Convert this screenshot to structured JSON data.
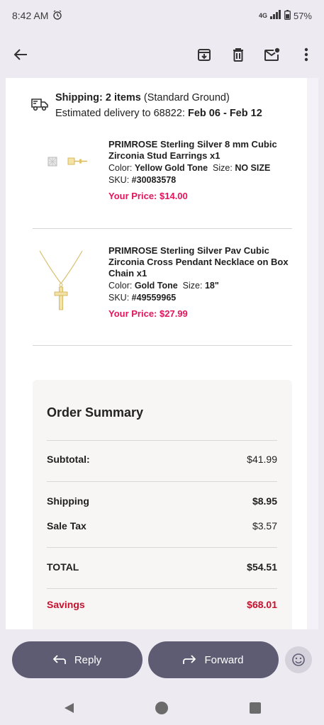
{
  "status_bar": {
    "time": "8:42 AM",
    "network": "4G",
    "battery": "57%"
  },
  "toolbar": {
    "back_icon": "arrow-left-icon",
    "archive_icon": "archive-icon",
    "delete_icon": "trash-icon",
    "mark_unread_icon": "mail-unread-icon",
    "more_icon": "more-vert-icon"
  },
  "shipping": {
    "label": "Shipping: 2 items",
    "method": "(Standard Ground)",
    "delivery_prefix": "Estimated delivery to 68822:",
    "delivery_dates": "Feb 06 - Feb 12"
  },
  "items": [
    {
      "name": "PRIMROSE Sterling Silver 8 mm Cubic Zirconia Stud Earrings x1",
      "color_label": "Color:",
      "color_value": "Yellow Gold Tone",
      "size_label": "Size:",
      "size_value": "NO SIZE",
      "sku_label": "SKU:",
      "sku_value": "#30083578",
      "price": "Your Price: $14.00"
    },
    {
      "name": "PRIMROSE Sterling Silver Pav Cubic Zirconia Cross Pendant Necklace on Box Chain x1",
      "color_label": "Color:",
      "color_value": "Gold Tone",
      "size_label": "Size:",
      "size_value": "18\"",
      "sku_label": "SKU:",
      "sku_value": "#49559965",
      "price": "Your Price: $27.99"
    }
  ],
  "summary": {
    "title": "Order Summary",
    "subtotal_label": "Subtotal:",
    "subtotal_value": "$41.99",
    "shipping_label": "Shipping",
    "shipping_value": "$8.95",
    "tax_label": "Sale Tax",
    "tax_value": "$3.57",
    "total_label": "TOTAL",
    "total_value": "$54.51",
    "savings_label": "Savings",
    "savings_value": "$68.01"
  },
  "actions": {
    "reply_label": "Reply",
    "forward_label": "Forward"
  },
  "colors": {
    "accent_price": "#e3165b",
    "savings": "#c8102e",
    "pill": "#5d5c73"
  }
}
